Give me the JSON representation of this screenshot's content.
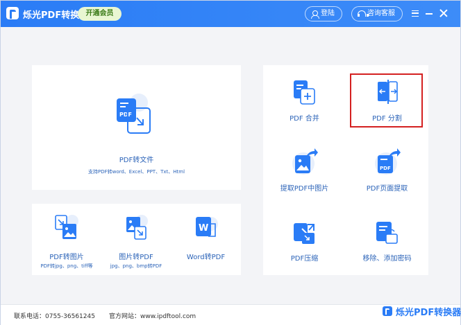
{
  "titlebar": {
    "app_title": "烁光PDF转换器",
    "vip_label": "开通会员",
    "login_label": "登陆",
    "support_label": "咨询客服"
  },
  "main_tool": {
    "label": "PDF转文件",
    "sub": "支持PDF转word、Excel、PPT、Txt、Html"
  },
  "small_tools": [
    {
      "label": "PDF转图片",
      "sub": "PDF转jpg、png、tiff等"
    },
    {
      "label": "图片转PDF",
      "sub": "jpg、png、bmp转PDF"
    },
    {
      "label": "Word转PDF",
      "sub": ""
    }
  ],
  "right_tools": [
    {
      "label": "PDF 合并"
    },
    {
      "label": "PDF 分割"
    },
    {
      "label": "提取PDF中图片"
    },
    {
      "label": "PDF页面提取"
    },
    {
      "label": "PDF压缩"
    },
    {
      "label": "移除、添加密码"
    }
  ],
  "footer": {
    "phone": "联系电话：0755-36561245",
    "site": "官方网站：www.ipdftool.com",
    "brand": "烁光PDF转换器"
  },
  "colors": {
    "accent": "#2a7cf6",
    "highlight": "#d42020"
  }
}
